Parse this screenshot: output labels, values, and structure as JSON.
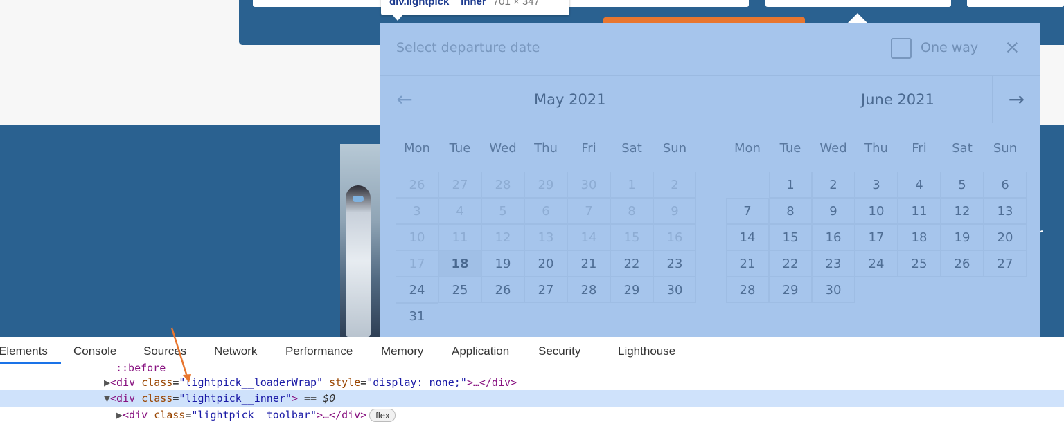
{
  "tooltip": {
    "element": "div.lightpick__inner",
    "size": "701 × 347"
  },
  "picker": {
    "title": "Select departure date",
    "one_way_label": "One way",
    "close_icon": "×",
    "prev_icon": "←",
    "next_icon": "→",
    "months": [
      {
        "name": "May  2021",
        "weekdays": [
          "Mon",
          "Tue",
          "Wed",
          "Thu",
          "Fri",
          "Sat",
          "Sun"
        ],
        "weeks": [
          [
            "26",
            "27",
            "28",
            "29",
            "30",
            "1",
            "2"
          ],
          [
            "3",
            "4",
            "5",
            "6",
            "7",
            "8",
            "9"
          ],
          [
            "10",
            "11",
            "12",
            "13",
            "14",
            "15",
            "16"
          ],
          [
            "17",
            "18",
            "19",
            "20",
            "21",
            "22",
            "23"
          ],
          [
            "24",
            "25",
            "26",
            "27",
            "28",
            "29",
            "30"
          ],
          [
            "31",
            "",
            "",
            "",
            "",
            "",
            ""
          ]
        ]
      },
      {
        "name": "June  2021",
        "weekdays": [
          "Mon",
          "Tue",
          "Wed",
          "Thu",
          "Fri",
          "Sat",
          "Sun"
        ],
        "weeks": [
          [
            "",
            "1",
            "2",
            "3",
            "4",
            "5",
            "6"
          ],
          [
            "7",
            "8",
            "9",
            "10",
            "11",
            "12",
            "13"
          ],
          [
            "14",
            "15",
            "16",
            "17",
            "18",
            "19",
            "20"
          ],
          [
            "21",
            "22",
            "23",
            "24",
            "25",
            "26",
            "27"
          ],
          [
            "28",
            "29",
            "30",
            "",
            "",
            "",
            ""
          ]
        ]
      }
    ],
    "today": "18"
  },
  "page": {
    "edge_text": "r"
  },
  "devtools": {
    "tabs": [
      "Elements",
      "Console",
      "Sources",
      "Network",
      "Performance",
      "Memory",
      "Application",
      "Security",
      "Lighthouse"
    ],
    "active_tab": "Elements",
    "lines": {
      "pseudo": "::before",
      "loader_tag_open": "<div ",
      "loader_attr1": "class",
      "loader_val1": "\"lightpick__loaderWrap\"",
      "loader_attr2": "style",
      "loader_val2": "\"display: none;\"",
      "loader_tail": ">…</div>",
      "inner_tag_open": "<div ",
      "inner_attr": "class",
      "inner_val": "\"lightpick__inner\"",
      "inner_tail": ">",
      "inner_marker": " == $0",
      "toolbar_tag_open": "<div ",
      "toolbar_attr": "class",
      "toolbar_val": "\"lightpick__toolbar\"",
      "toolbar_tail": ">…</div>",
      "flex_badge": "flex"
    }
  },
  "colors": {
    "page_blue": "#2a6190",
    "overlay": "#5d96dc",
    "orange": "#e8762f",
    "arrow": "#e8762f"
  }
}
